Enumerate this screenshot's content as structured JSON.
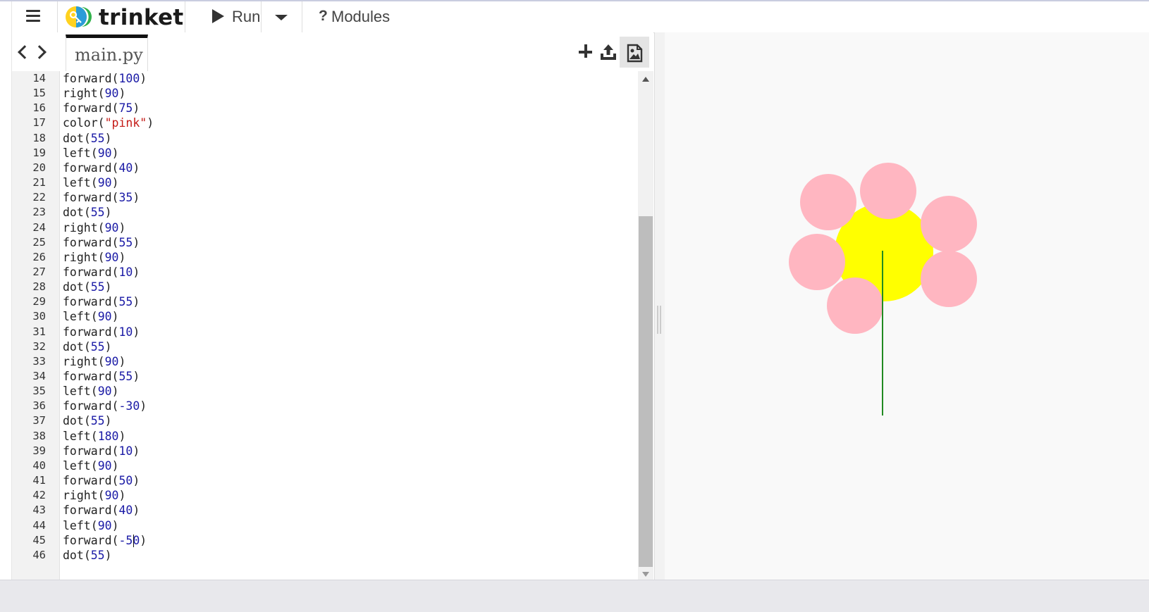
{
  "app": {
    "name": "trinket",
    "toolbar": {
      "run_label": "Run",
      "modules_icon": "?",
      "modules_label": "Modules"
    }
  },
  "editor": {
    "active_tab": "main.py",
    "active_line": 45,
    "lines": [
      {
        "n": "14",
        "fn": "forward",
        "arg": "100",
        "t": "num"
      },
      {
        "n": "15",
        "fn": "right",
        "arg": "90",
        "t": "num"
      },
      {
        "n": "16",
        "fn": "forward",
        "arg": "75",
        "t": "num"
      },
      {
        "n": "17",
        "fn": "color",
        "arg": "\"pink\"",
        "t": "str"
      },
      {
        "n": "18",
        "fn": "dot",
        "arg": "55",
        "t": "num"
      },
      {
        "n": "19",
        "fn": "left",
        "arg": "90",
        "t": "num"
      },
      {
        "n": "20",
        "fn": "forward",
        "arg": "40",
        "t": "num"
      },
      {
        "n": "21",
        "fn": "left",
        "arg": "90",
        "t": "num"
      },
      {
        "n": "22",
        "fn": "forward",
        "arg": "35",
        "t": "num"
      },
      {
        "n": "23",
        "fn": "dot",
        "arg": "55",
        "t": "num"
      },
      {
        "n": "24",
        "fn": "right",
        "arg": "90",
        "t": "num"
      },
      {
        "n": "25",
        "fn": "forward",
        "arg": "55",
        "t": "num"
      },
      {
        "n": "26",
        "fn": "right",
        "arg": "90",
        "t": "num"
      },
      {
        "n": "27",
        "fn": "forward",
        "arg": "10",
        "t": "num"
      },
      {
        "n": "28",
        "fn": "dot",
        "arg": "55",
        "t": "num"
      },
      {
        "n": "29",
        "fn": "forward",
        "arg": "55",
        "t": "num"
      },
      {
        "n": "30",
        "fn": "left",
        "arg": "90",
        "t": "num"
      },
      {
        "n": "31",
        "fn": "forward",
        "arg": "10",
        "t": "num"
      },
      {
        "n": "32",
        "fn": "dot",
        "arg": "55",
        "t": "num"
      },
      {
        "n": "33",
        "fn": "right",
        "arg": "90",
        "t": "num"
      },
      {
        "n": "34",
        "fn": "forward",
        "arg": "55",
        "t": "num"
      },
      {
        "n": "35",
        "fn": "left",
        "arg": "90",
        "t": "num"
      },
      {
        "n": "36",
        "fn": "forward",
        "arg": "-30",
        "t": "num"
      },
      {
        "n": "37",
        "fn": "dot",
        "arg": "55",
        "t": "num"
      },
      {
        "n": "38",
        "fn": "left",
        "arg": "180",
        "t": "num"
      },
      {
        "n": "39",
        "fn": "forward",
        "arg": "10",
        "t": "num"
      },
      {
        "n": "40",
        "fn": "left",
        "arg": "90",
        "t": "num"
      },
      {
        "n": "41",
        "fn": "forward",
        "arg": "50",
        "t": "num"
      },
      {
        "n": "42",
        "fn": "right",
        "arg": "90",
        "t": "num"
      },
      {
        "n": "43",
        "fn": "forward",
        "arg": "40",
        "t": "num"
      },
      {
        "n": "44",
        "fn": "left",
        "arg": "90",
        "t": "num"
      },
      {
        "n": "45",
        "fn": "forward",
        "arg": "-50",
        "t": "num"
      },
      {
        "n": "46",
        "fn": "dot",
        "arg": "55",
        "t": "num"
      }
    ]
  },
  "output": {
    "colors": {
      "background": "#f9f9f9",
      "center": "#ffff00",
      "petals": "#ffb6c1",
      "stem": "#228b22"
    }
  },
  "icons": {
    "menu": "hamburger-icon",
    "logo": "trinket-logo-icon",
    "run": "play-icon",
    "run_dropdown": "caret-down-icon",
    "prev": "chevron-left-icon",
    "next": "chevron-right-icon",
    "add": "plus-icon",
    "upload": "upload-icon",
    "image": "image-icon"
  }
}
